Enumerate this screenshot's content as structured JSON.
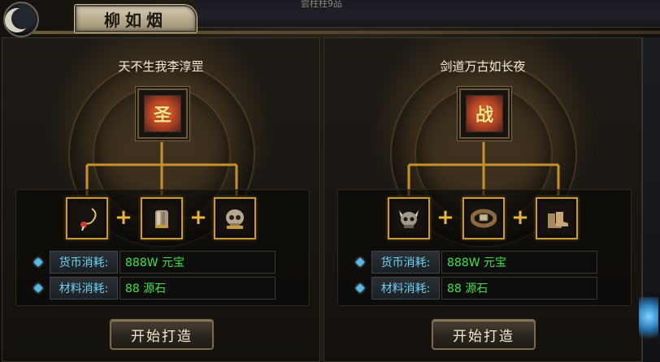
{
  "window": {
    "title": "柳如烟",
    "top_ghost_text": "尝柱柱9品"
  },
  "colors": {
    "accent_gold": "#c99a2e",
    "cost_label": "#6fd2f0",
    "cost_value": "#3fe24a"
  },
  "panels": [
    {
      "set_name": "天不生我李淳罡",
      "main_item": {
        "icon": "saint-scroll-icon",
        "glyph": "圣"
      },
      "materials": [
        {
          "icon": "tassel-pendant-icon",
          "glyph": "✦"
        },
        {
          "icon": "gauntlet-icon",
          "glyph": "✊"
        },
        {
          "icon": "skull-helmet-icon",
          "glyph": "☠"
        }
      ],
      "plus": "+",
      "currency_label": "货币消耗:",
      "currency_value": "888W 元宝",
      "material_label": "材料消耗:",
      "material_value": "88 源石",
      "button_label": "开始打造"
    },
    {
      "set_name": "剑道万古如长夜",
      "main_item": {
        "icon": "war-scroll-icon",
        "glyph": "战"
      },
      "materials": [
        {
          "icon": "horned-helmet-icon",
          "glyph": "☠"
        },
        {
          "icon": "belt-icon",
          "glyph": "▭"
        },
        {
          "icon": "boots-icon",
          "glyph": "👢"
        }
      ],
      "plus": "+",
      "currency_label": "货币消耗:",
      "currency_value": "888W 元宝",
      "material_label": "材料消耗:",
      "material_value": "88  源石",
      "button_label": "开始打造"
    }
  ]
}
